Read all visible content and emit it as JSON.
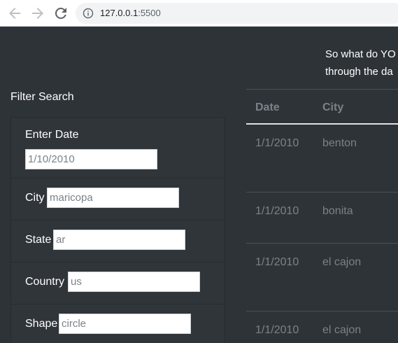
{
  "browser": {
    "url_host": "127.0.0.1",
    "url_port": ":5500",
    "icons": {
      "back": "back-arrow-icon",
      "forward": "forward-arrow-icon",
      "reload": "reload-icon",
      "info": "info-icon"
    }
  },
  "page": {
    "intro_line1": "So what do YO",
    "intro_line2": "through the da",
    "filter_title": "Filter Search",
    "filters": {
      "date": {
        "label": "Enter Date",
        "value": "1/10/2010"
      },
      "city": {
        "label": "City",
        "value": "maricopa"
      },
      "state": {
        "label": "State",
        "value": "ar"
      },
      "country": {
        "label": "Country",
        "value": "us"
      },
      "shape": {
        "label": "Shape",
        "value": "circle"
      }
    },
    "table": {
      "columns": [
        "Date",
        "City"
      ],
      "rows": [
        {
          "date": "1/1/2010",
          "city": "benton"
        },
        {
          "date": "1/1/2010",
          "city": "bonita"
        },
        {
          "date": "1/1/2010",
          "city": "el cajon"
        },
        {
          "date": "1/1/2010",
          "city": "el cajon"
        }
      ]
    }
  },
  "colors": {
    "page_bg": "#2e3338",
    "muted_text": "#7b8288"
  }
}
